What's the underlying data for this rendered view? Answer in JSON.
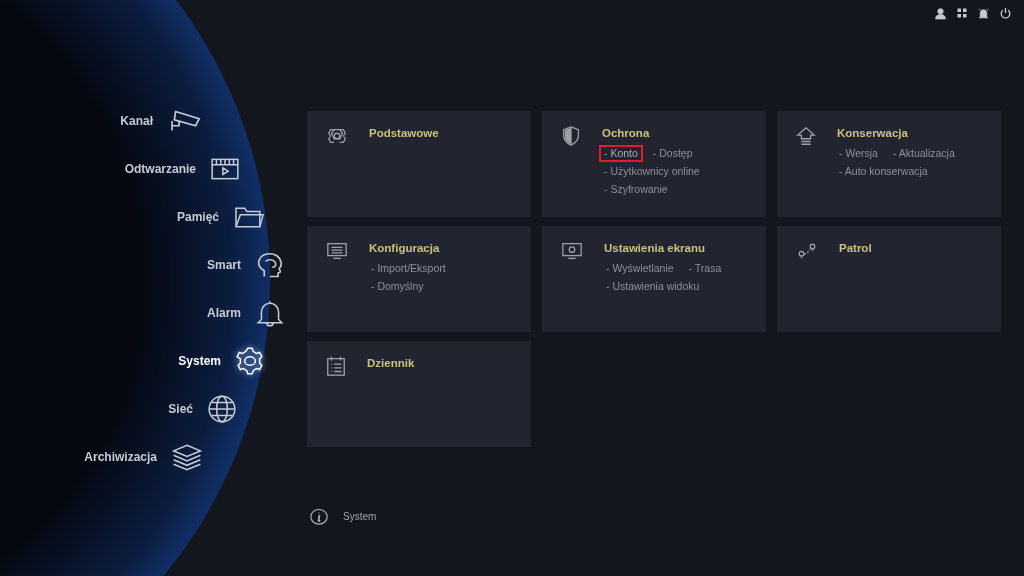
{
  "nav": [
    {
      "label": "Kanał",
      "kind": "camera",
      "selected": false
    },
    {
      "label": "Odtwarzanie",
      "kind": "film",
      "selected": false
    },
    {
      "label": "Pamięć",
      "kind": "folder",
      "selected": false
    },
    {
      "label": "Smart",
      "kind": "head",
      "selected": false
    },
    {
      "label": "Alarm",
      "kind": "bell",
      "selected": false
    },
    {
      "label": "System",
      "kind": "gear",
      "selected": true
    },
    {
      "label": "Sieć",
      "kind": "globe",
      "selected": false
    },
    {
      "label": "Archiwizacja",
      "kind": "layers",
      "selected": false
    }
  ],
  "cards": [
    {
      "title": "Podstawowe",
      "kind": "gear"
    },
    {
      "title": "Ochrona",
      "kind": "shield",
      "lines": [
        [
          {
            "text": "- Konto",
            "highlighted": true
          },
          {
            "text": "- Dostęp",
            "highlighted": false
          }
        ],
        [
          {
            "text": "- Użytkownicy online",
            "highlighted": false
          }
        ],
        [
          {
            "text": "- Szyfrowanie",
            "highlighted": false
          }
        ]
      ]
    },
    {
      "title": "Konserwacja",
      "kind": "upgrade",
      "lines": [
        [
          {
            "text": "- Wersja",
            "highlighted": false
          },
          {
            "text": "- Aktualizacja",
            "highlighted": false
          }
        ],
        [
          {
            "text": "- Auto konserwacja",
            "highlighted": false
          }
        ]
      ]
    },
    {
      "title": "Konfiguracja",
      "kind": "monitor-list",
      "lines": [
        [
          {
            "text": "- Import/Eksport",
            "highlighted": false
          }
        ],
        [
          {
            "text": "- Domyślny",
            "highlighted": false
          }
        ]
      ]
    },
    {
      "title": "Ustawienia ekranu",
      "kind": "monitor-gear",
      "lines": [
        [
          {
            "text": "- Wyświetlanie",
            "highlighted": false
          },
          {
            "text": "- Trasa",
            "highlighted": false
          }
        ],
        [
          {
            "text": "- Ustawienia widoku",
            "highlighted": false
          }
        ]
      ]
    },
    {
      "title": "Patrol",
      "kind": "route"
    },
    {
      "title": "Dziennik",
      "kind": "list"
    }
  ],
  "footer": {
    "text": "System"
  }
}
